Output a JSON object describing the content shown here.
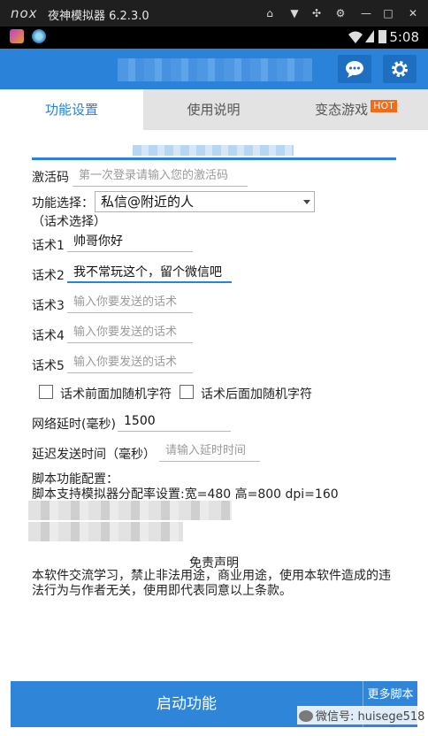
{
  "emulator": {
    "logo": "nox",
    "title": "夜神模拟器 6.2.3.0"
  },
  "status_bar": {
    "time": "5:08"
  },
  "tabs": [
    {
      "label": "功能设置"
    },
    {
      "label": "使用说明"
    },
    {
      "label": "变态游戏",
      "badge": "HOT"
    }
  ],
  "form": {
    "activation_label": "激活码",
    "activation_placeholder": "第一次登录请输入您的激活码",
    "function_label": "功能选择：",
    "function_value": "私信@附近的人",
    "function_hint": "（话术选择）",
    "scripts": [
      {
        "label": "话术1",
        "value": "帅哥你好"
      },
      {
        "label": "话术2",
        "value": "我不常玩这个，留个微信吧"
      },
      {
        "label": "话术3",
        "placeholder": "输入你要发送的话术"
      },
      {
        "label": "话术4",
        "placeholder": "输入你要发送的话术"
      },
      {
        "label": "话术5",
        "placeholder": "输入你要发送的话术"
      }
    ],
    "checkbox_prefix": "话术前面加随机字符",
    "checkbox_suffix": "话术后面加随机字符",
    "delay_label": "网络延时(毫秒)",
    "delay_value": "1500",
    "send_delay_label": "延迟发送时间（毫秒）",
    "send_delay_placeholder": "请输入延时时间"
  },
  "script_config": {
    "title": "脚本功能配置：",
    "resolution": "脚本支持模拟器分配率设置:宽=480 高=800 dpi=160"
  },
  "disclaimer": {
    "title": "免责声明",
    "text": "本软件交流学习，禁止非法用途，商业用途，使用本软件造成的违法行为与作者无关，使用即代表同意以上条款。"
  },
  "actions": {
    "start": "启动功能",
    "more": "更多脚本"
  },
  "watermark": "微信号: huisege518",
  "colors": {
    "accent": "#2a82d9",
    "hot_badge": "#f36b18"
  }
}
